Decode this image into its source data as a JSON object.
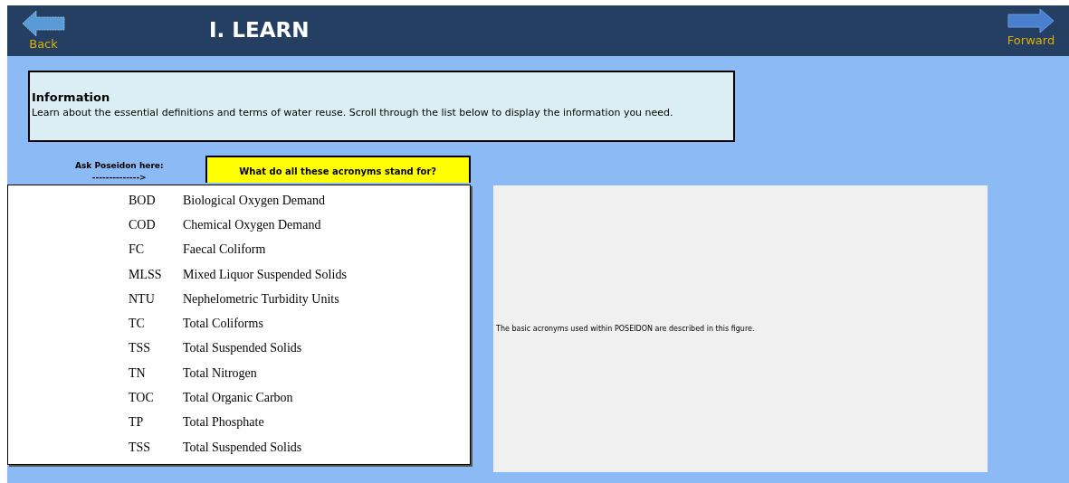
{
  "header": {
    "title": "I. LEARN",
    "back": "Back",
    "forward": "Forward"
  },
  "information": {
    "heading": "Information",
    "text": "Learn about the essential definitions and terms of water reuse. Scroll through the list below to display the information you need."
  },
  "ask": {
    "label": "Ask Poseidon here:",
    "arrow": "-------------->",
    "question": "What do all these acronyms stand for?"
  },
  "acronyms": [
    {
      "abbr": "BOD",
      "meaning": "Biological Oxygen Demand"
    },
    {
      "abbr": "COD",
      "meaning": "Chemical Oxygen Demand"
    },
    {
      "abbr": "FC",
      "meaning": "Faecal Coliform"
    },
    {
      "abbr": "MLSS",
      "meaning": "Mixed Liquor Suspended Solids"
    },
    {
      "abbr": "NTU",
      "meaning": "Nephelometric Turbidity Units"
    },
    {
      "abbr": "TC",
      "meaning": "Total Coliforms"
    },
    {
      "abbr": "TSS",
      "meaning": "Total Suspended Solids"
    },
    {
      "abbr": "TN",
      "meaning": "Total Nitrogen"
    },
    {
      "abbr": "TOC",
      "meaning": "Total Organic Carbon"
    },
    {
      "abbr": "TP",
      "meaning": "Total Phosphate"
    },
    {
      "abbr": "TSS",
      "meaning": "Total Suspended Solids"
    }
  ],
  "figure": {
    "caption": "The basic acronyms used within POSEIDON are described in this figure."
  }
}
